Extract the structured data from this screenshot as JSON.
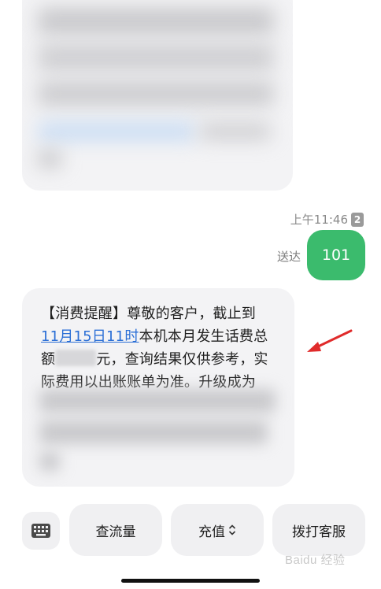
{
  "message_meta": {
    "time": "上午11:46",
    "sim": "2"
  },
  "outgoing": {
    "text": "101",
    "status": "送达"
  },
  "incoming": {
    "line1": "【消费提醒】尊敬的客户，截止到",
    "link": "11月15日11时",
    "line2_rest": "本机本月发生话费总",
    "line3_start": "额",
    "line3_rest": "元，查询结果仅供参考，实",
    "line4": "际费用以出账账单为准。升级成为"
  },
  "quick_actions": {
    "query_data": "查流量",
    "recharge": "充值",
    "call_service": "拨打客服"
  },
  "icons": {
    "keyboard": "keyboard-icon",
    "sort": "chevron-updown-icon",
    "annotation_arrow": "red-arrow"
  },
  "colors": {
    "outgoing_bubble": "#3bbb6d",
    "link": "#2b6fd6",
    "arrow": "#e02b2b"
  },
  "watermark": "Baidu 经验"
}
